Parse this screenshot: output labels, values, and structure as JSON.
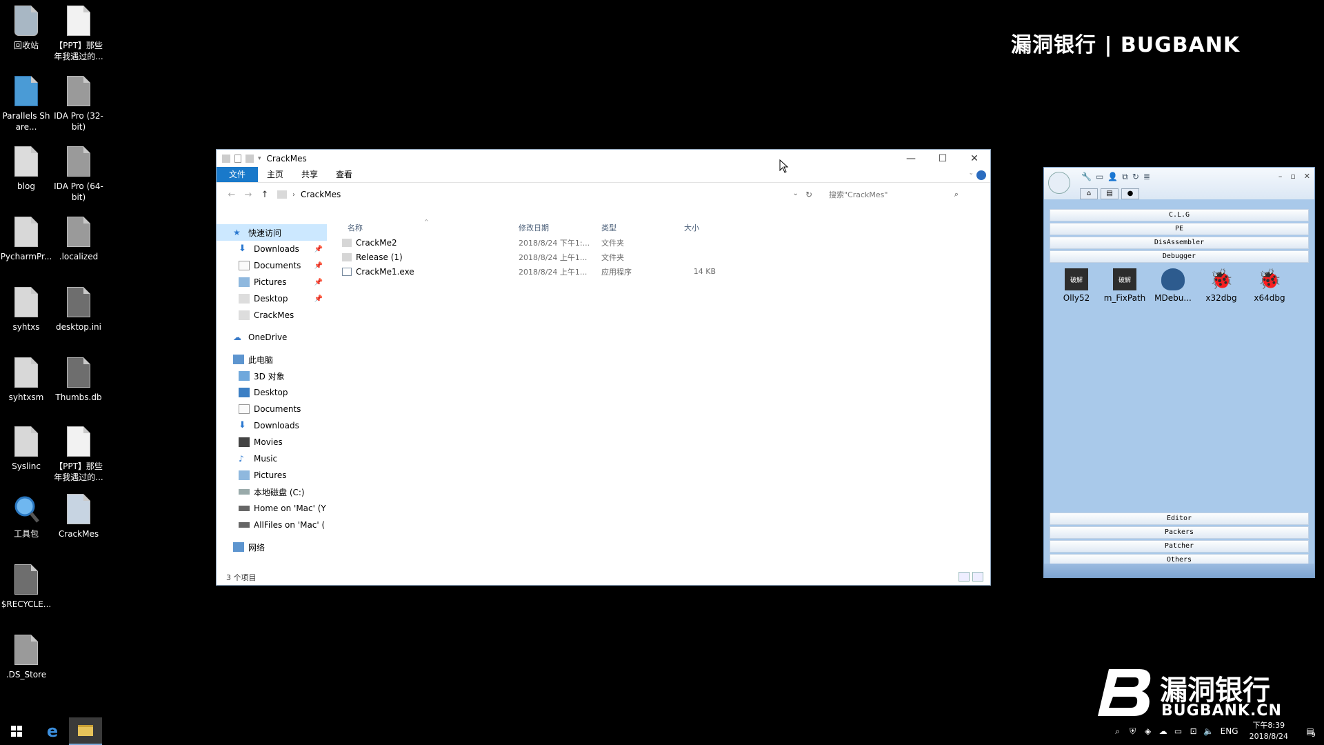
{
  "desktop": {
    "icons": [
      {
        "label": "回收站",
        "icon": "recycle-bin-icon"
      },
      {
        "label": "【PPT】那些年我遇过的...",
        "icon": "document-icon"
      },
      {
        "label": "Parallels Share...",
        "icon": "parallels-share-icon"
      },
      {
        "label": "IDA Pro (32-bit)",
        "icon": "ida-pro-icon"
      },
      {
        "label": "blog",
        "icon": "shortcut-file-icon"
      },
      {
        "label": "IDA Pro (64-bit)",
        "icon": "ida-pro-icon"
      },
      {
        "label": "PycharmPr...",
        "icon": "file-icon"
      },
      {
        "label": ".localized",
        "icon": "file-icon"
      },
      {
        "label": "syhtxs",
        "icon": "file-icon"
      },
      {
        "label": "desktop.ini",
        "icon": "settings-file-icon"
      },
      {
        "label": "syhtxsm",
        "icon": "file-icon"
      },
      {
        "label": "Thumbs.db",
        "icon": "settings-file-icon"
      },
      {
        "label": "Syslinc",
        "icon": "file-icon"
      },
      {
        "label": "【PPT】那些年我遇过的...",
        "icon": "document-icon"
      },
      {
        "label": "工具包",
        "icon": "magnifier-icon"
      },
      {
        "label": "CrackMes",
        "icon": "shortcut-file-icon"
      },
      {
        "label": "$RECYCLE...",
        "icon": "file-icon"
      },
      {
        "label": ".DS_Store",
        "icon": "file-icon"
      }
    ],
    "watermark_top": "漏洞银行 | BUGBANK",
    "watermark_bottom_cn": "漏洞银行",
    "watermark_bottom_en": "BUGBANK.CN"
  },
  "explorer": {
    "title": "CrackMes",
    "tabs": [
      "文件",
      "主页",
      "共享",
      "查看"
    ],
    "path": "CrackMes",
    "search_placeholder": "搜索\"CrackMes\"",
    "nav": {
      "quick_access": "快速访问",
      "quick_items": [
        "Downloads",
        "Documents",
        "Pictures",
        "Desktop",
        "CrackMes"
      ],
      "onedrive": "OneDrive",
      "this_pc": "此电脑",
      "pc_items": [
        "3D 对象",
        "Desktop",
        "Documents",
        "Downloads",
        "Movies",
        "Music",
        "Pictures",
        "本地磁盘 (C:)",
        "Home on 'Mac' (Y",
        "AllFiles on 'Mac' ("
      ],
      "network": "网络"
    },
    "columns": {
      "name": "名称",
      "date": "修改日期",
      "type": "类型",
      "size": "大小"
    },
    "files": [
      {
        "name": "CrackMe2",
        "date": "2018/8/24 下午1:...",
        "type": "文件夹",
        "size": ""
      },
      {
        "name": "Release (1)",
        "date": "2018/8/24 上午1...",
        "type": "文件夹",
        "size": ""
      },
      {
        "name": "CrackMe1.exe",
        "date": "2018/8/24 上午1...",
        "type": "应用程序",
        "size": "14 KB"
      }
    ],
    "status": "3 个项目"
  },
  "toolbox": {
    "categories_top": [
      "C.L.G",
      "PE",
      "DisAssembler",
      "Debugger"
    ],
    "tools": [
      {
        "label": "Olly52",
        "glyph": "破解"
      },
      {
        "label": "m_FixPath",
        "glyph": "破解"
      },
      {
        "label": "MDebu...",
        "glyph": ""
      },
      {
        "label": "x32dbg",
        "glyph": "🐞"
      },
      {
        "label": "x64dbg",
        "glyph": "🐞"
      }
    ],
    "categories_bottom": [
      "Editor",
      "Packers",
      "Patcher",
      "Others"
    ]
  },
  "taskbar": {
    "language": "ENG",
    "time": "下午8:39",
    "date": "2018/8/24",
    "notification_count": "9"
  }
}
